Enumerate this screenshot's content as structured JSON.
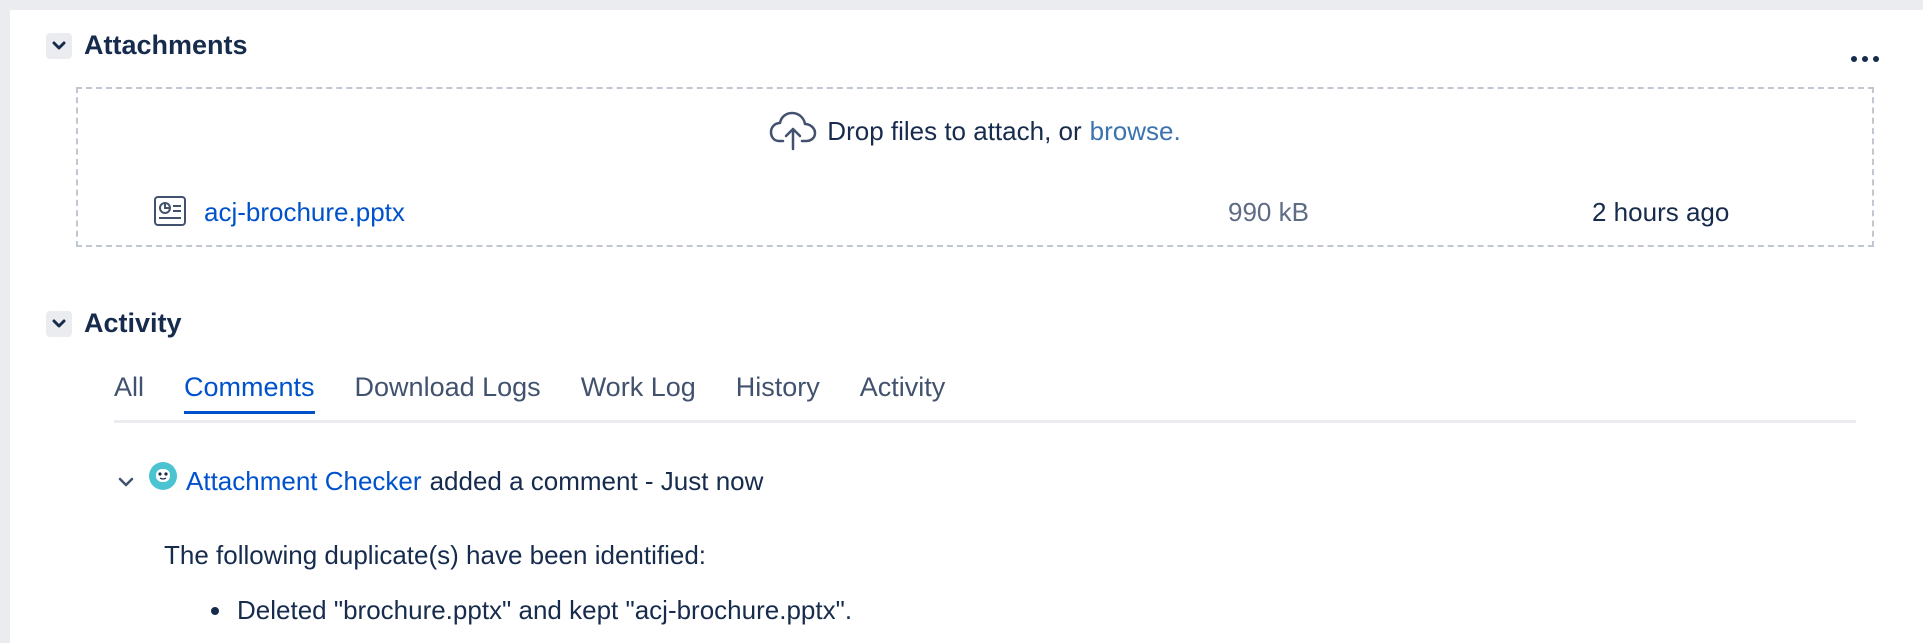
{
  "attachments": {
    "title": "Attachments",
    "drop_text": "Drop files to attach, or",
    "browse_label": "browse.",
    "files": [
      {
        "name": "acj-brochure.pptx",
        "size": "990 kB",
        "date": "2 hours ago"
      }
    ]
  },
  "activity": {
    "title": "Activity",
    "tabs": [
      "All",
      "Comments",
      "Download Logs",
      "Work Log",
      "History",
      "Activity"
    ],
    "active_tab": "Comments",
    "comment": {
      "author": "Attachment Checker",
      "action": "added a comment - Just now",
      "body": "The following duplicate(s) have been identified:",
      "items": [
        "Deleted \"brochure.pptx\" and kept \"acj-brochure.pptx\"."
      ]
    }
  },
  "colors": {
    "link": "#0052cc",
    "browse_link": "#3b73af",
    "text": "#172b4d",
    "muted": "#5e6c84",
    "avatar": "#4bc3d0"
  }
}
